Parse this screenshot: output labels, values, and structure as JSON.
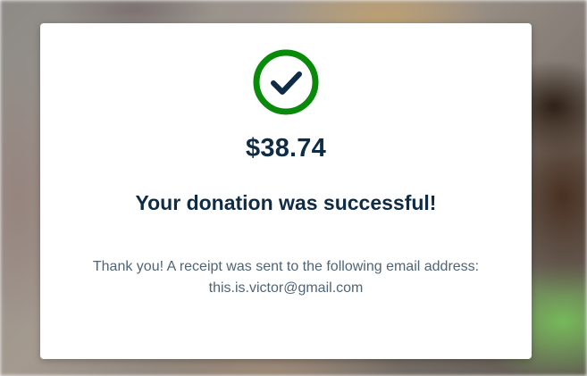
{
  "background": {
    "description_icon": "photo-background"
  },
  "confirmation": {
    "icon": "check-circle-icon",
    "icon_color": "#0a8a0a",
    "amount": "$38.74",
    "headline": "Your donation was successful!",
    "message_line1": "Thank you! A receipt was sent to the following email address:",
    "email": "this.is.victor@gmail.com"
  },
  "colors": {
    "heading": "#0f2c46",
    "body_text": "#4f6476",
    "card_bg": "#ffffff"
  }
}
